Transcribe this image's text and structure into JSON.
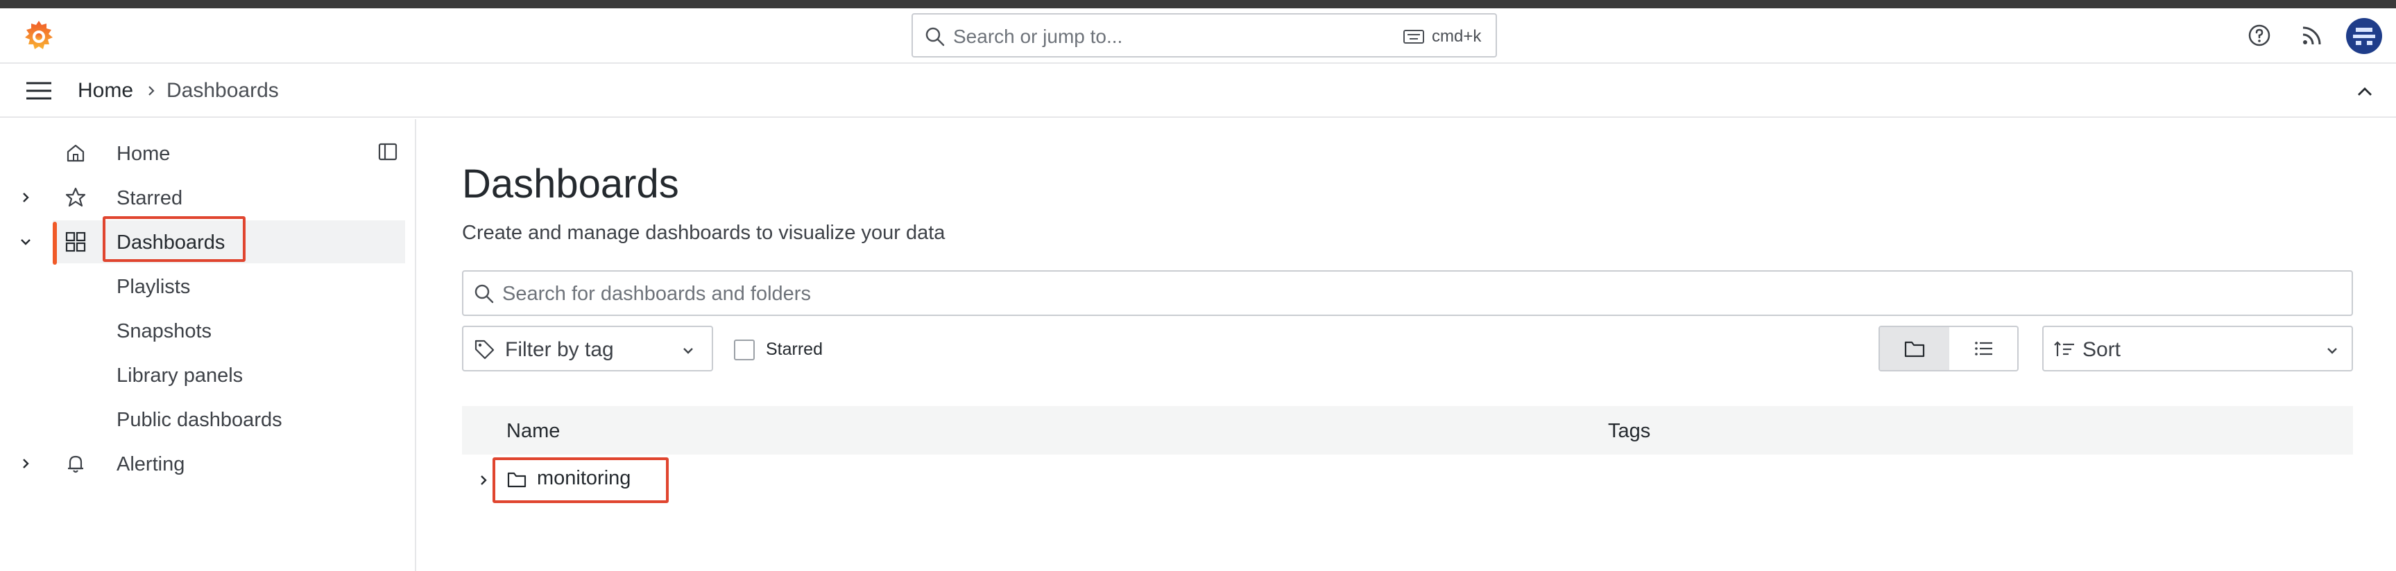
{
  "topbar": {
    "search_placeholder": "Search or jump to...",
    "search_shortcut": "cmd+k"
  },
  "breadcrumb": {
    "home": "Home",
    "current": "Dashboards"
  },
  "sidebar": {
    "items": [
      {
        "label": "Home",
        "icon": "home-icon"
      },
      {
        "label": "Starred",
        "icon": "star-icon"
      },
      {
        "label": "Dashboards",
        "icon": "apps-icon",
        "active": true
      },
      {
        "label": "Playlists"
      },
      {
        "label": "Snapshots"
      },
      {
        "label": "Library panels"
      },
      {
        "label": "Public dashboards"
      },
      {
        "label": "Alerting",
        "icon": "bell-icon"
      }
    ]
  },
  "main": {
    "title": "Dashboards",
    "subtitle": "Create and manage dashboards to visualize your data",
    "search_placeholder": "Search for dashboards and folders",
    "filter_by_tag": "Filter by tag",
    "starred_label": "Starred",
    "sort_label": "Sort",
    "table": {
      "columns": [
        "Name",
        "Tags"
      ],
      "rows": [
        {
          "name": "monitoring",
          "type": "folder"
        }
      ]
    }
  },
  "colors": {
    "accent": "#f05a28",
    "highlight_box": "#e0452f",
    "avatar": "#1f3d8a"
  }
}
